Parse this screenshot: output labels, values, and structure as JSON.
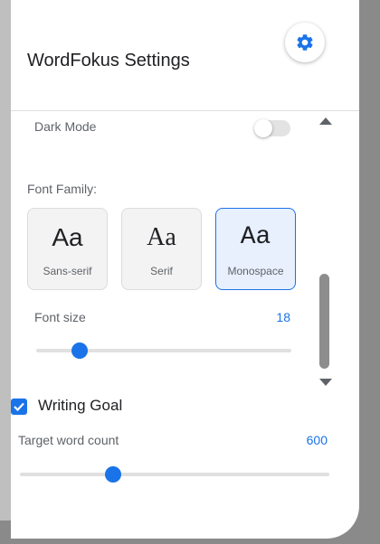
{
  "panel": {
    "title": "WordFokus Settings",
    "settings_button_icon": "gear-icon"
  },
  "appearance": {
    "dark_mode_label": "Dark Mode",
    "dark_mode_enabled": false,
    "font_family_label": "Font Family:",
    "font_options": [
      {
        "sample": "Aa",
        "label": "Sans-serif",
        "selected": false
      },
      {
        "sample": "Aa",
        "label": "Serif",
        "selected": false
      },
      {
        "sample": "Aa",
        "label": "Monospace",
        "selected": true
      }
    ],
    "font_size_label": "Font size",
    "font_size_value": "18",
    "font_size_level": 0.17
  },
  "goal": {
    "enabled": true,
    "title": "Writing Goal",
    "target_label": "Target word count",
    "target_value": "600",
    "target_level": 0.3
  },
  "colors": {
    "accent": "#1a73e8",
    "toggle_off": "#e3e3e3",
    "selected_card_bg": "#e8f0fe"
  }
}
